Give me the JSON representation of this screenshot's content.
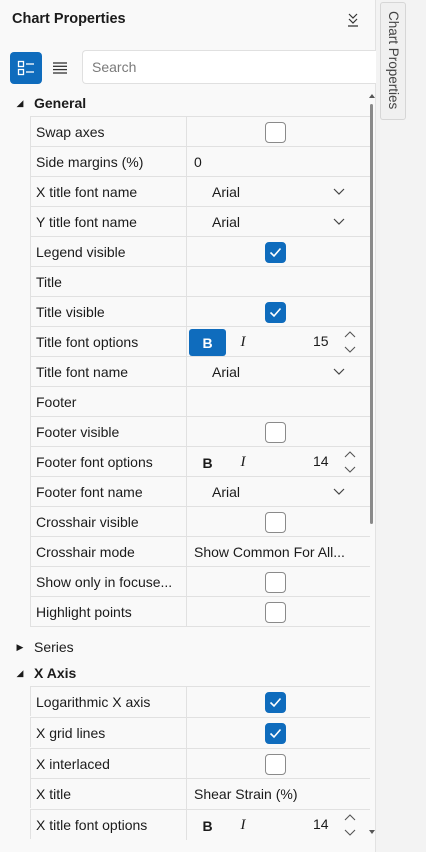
{
  "panel": {
    "title": "Chart Properties"
  },
  "search": {
    "placeholder": "Search"
  },
  "side_tab": {
    "label": "Chart Properties"
  },
  "categories": {
    "general": "General",
    "series": "Series",
    "x_axis": "X Axis"
  },
  "rows": {
    "swap_axes": {
      "name": "Swap axes",
      "checked": false
    },
    "side_margins": {
      "name": "Side margins (%)",
      "value": "0"
    },
    "x_title_font_name": {
      "name": "X title font name",
      "value": "Arial"
    },
    "y_title_font_name": {
      "name": "Y title font name",
      "value": "Arial"
    },
    "legend_visible": {
      "name": "Legend visible",
      "checked": true
    },
    "title": {
      "name": "Title",
      "value": ""
    },
    "title_visible": {
      "name": "Title visible",
      "checked": true
    },
    "title_font_options": {
      "name": "Title font options",
      "bold": "B",
      "italic": "I",
      "size": "15",
      "bold_active": true
    },
    "title_font_name": {
      "name": "Title font name",
      "value": "Arial"
    },
    "footer": {
      "name": "Footer",
      "value": ""
    },
    "footer_visible": {
      "name": "Footer visible",
      "checked": false
    },
    "footer_font_options": {
      "name": "Footer font options",
      "bold": "B",
      "italic": "I",
      "size": "14",
      "bold_active": false
    },
    "footer_font_name": {
      "name": "Footer font name",
      "value": "Arial"
    },
    "crosshair_visible": {
      "name": "Crosshair visible",
      "checked": false
    },
    "crosshair_mode": {
      "name": "Crosshair mode",
      "value": "Show Common For All..."
    },
    "show_only_in_focused": {
      "name": "Show only in focuse...",
      "checked": false
    },
    "highlight_points": {
      "name": "Highlight points",
      "checked": false
    },
    "logarithmic_x_axis": {
      "name": "Logarithmic X axis",
      "checked": true
    },
    "x_grid_lines": {
      "name": "X grid lines",
      "checked": true
    },
    "x_interlaced": {
      "name": "X interlaced",
      "checked": false
    },
    "x_title": {
      "name": "X title",
      "value": "Shear Strain (%)"
    },
    "x_title_font_options": {
      "name": "X title font options",
      "bold": "B",
      "italic": "I",
      "size": "14",
      "bold_active": false
    }
  },
  "colors": {
    "accent": "#0f6cbd",
    "panel_bg": "#f9f9f9",
    "grid_line": "#e1e1e1"
  }
}
